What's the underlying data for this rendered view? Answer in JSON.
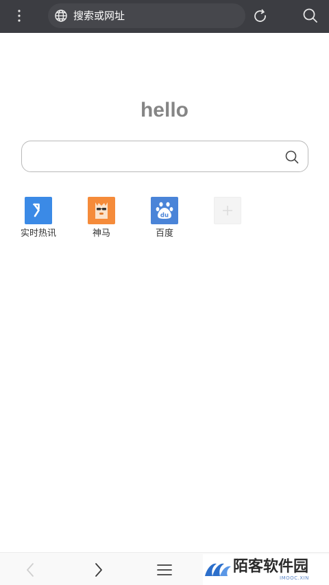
{
  "browser": {
    "address_placeholder": "搜索或网址",
    "icons": {
      "menu": "more-vertical-icon",
      "globe": "globe-icon",
      "refresh": "refresh-icon",
      "search": "search-icon"
    }
  },
  "home": {
    "greeting": "hello",
    "search_value": "",
    "shortcuts": [
      {
        "label": "实时热讯",
        "icon": "trending-arrow-icon",
        "color": "#3b8ae6"
      },
      {
        "label": "神马",
        "icon": "alpaca-logo-icon",
        "color": "#f58b3a"
      },
      {
        "label": "百度",
        "icon": "baidu-paw-icon",
        "color": "#4a84d8"
      },
      {
        "label": "",
        "icon": "add-icon",
        "color": "#f4f4f4"
      }
    ]
  },
  "bottom_nav": {
    "icons": [
      "back-arrow-icon",
      "forward-arrow-icon",
      "menu-hamburger-icon"
    ]
  },
  "watermark": {
    "text": "陌客软件园",
    "subtext": "IMOOC.XIN",
    "color": "#2c6fcb"
  }
}
